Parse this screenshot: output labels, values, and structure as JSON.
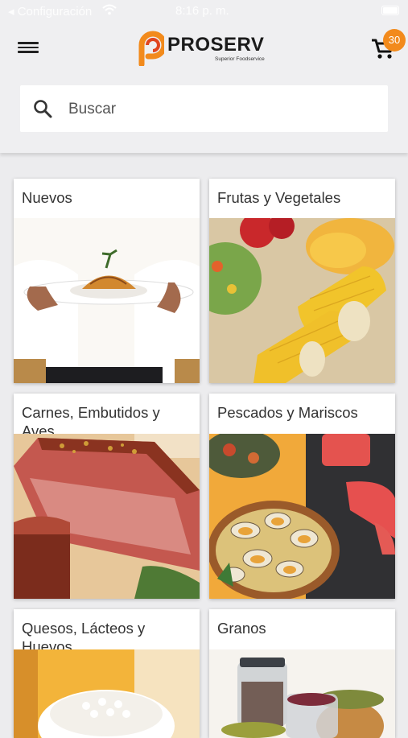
{
  "statusbar": {
    "back_app": "◂ Configuración",
    "time": "8:16 p. m."
  },
  "header": {
    "brand": "PROSERV",
    "tagline": "Superior Foodservice",
    "cart_count": "30"
  },
  "search": {
    "placeholder": "Buscar"
  },
  "categories": [
    {
      "title": "Nuevos"
    },
    {
      "title": "Frutas y Vegetales"
    },
    {
      "title": "Carnes, Embutidos y Aves"
    },
    {
      "title": "Pescados y Mariscos"
    },
    {
      "title": "Quesos, Lácteos y Huevos"
    },
    {
      "title": "Granos"
    }
  ],
  "colors": {
    "accent": "#f28a1c",
    "background": "#ececee"
  },
  "icons": {
    "menu": "hamburger-icon",
    "cart": "cart-icon",
    "search": "search-icon"
  }
}
